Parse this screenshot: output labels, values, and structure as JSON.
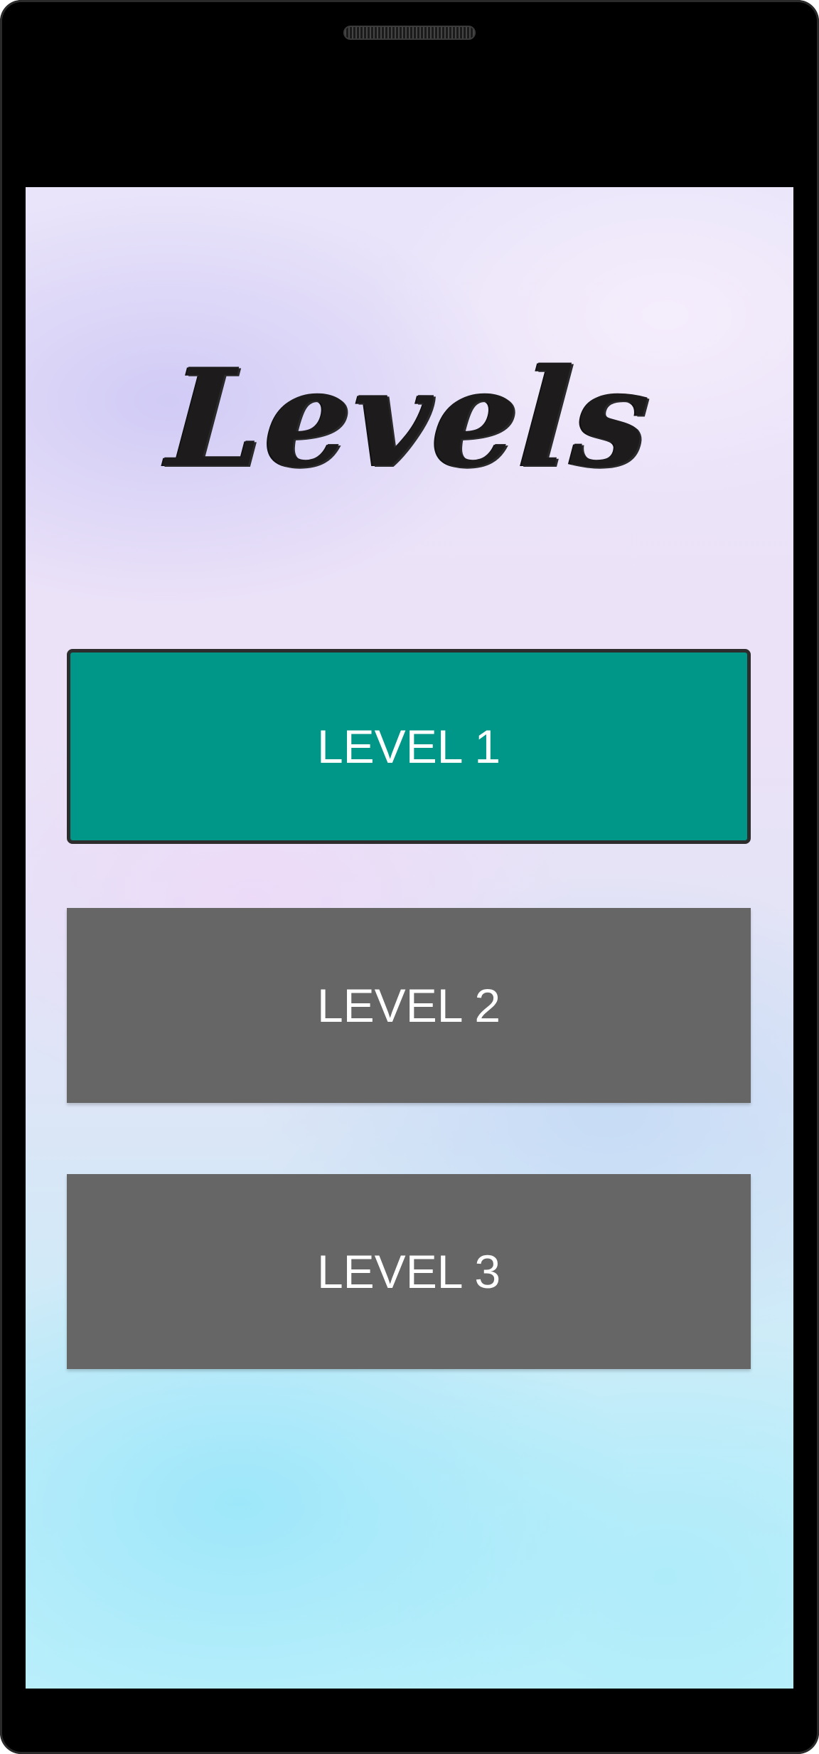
{
  "screen": {
    "title": "Levels"
  },
  "levels": [
    {
      "label": "LEVEL 1",
      "state": "selected",
      "color": "#009688"
    },
    {
      "label": "LEVEL 2",
      "state": "default",
      "color": "#666666"
    },
    {
      "label": "LEVEL 3",
      "state": "default",
      "color": "#666666"
    }
  ],
  "colors": {
    "device_frame": "#000000",
    "selected_button": "#009688",
    "default_button": "#666666",
    "button_text": "#ffffff",
    "title_text": "#1d1b1c"
  }
}
